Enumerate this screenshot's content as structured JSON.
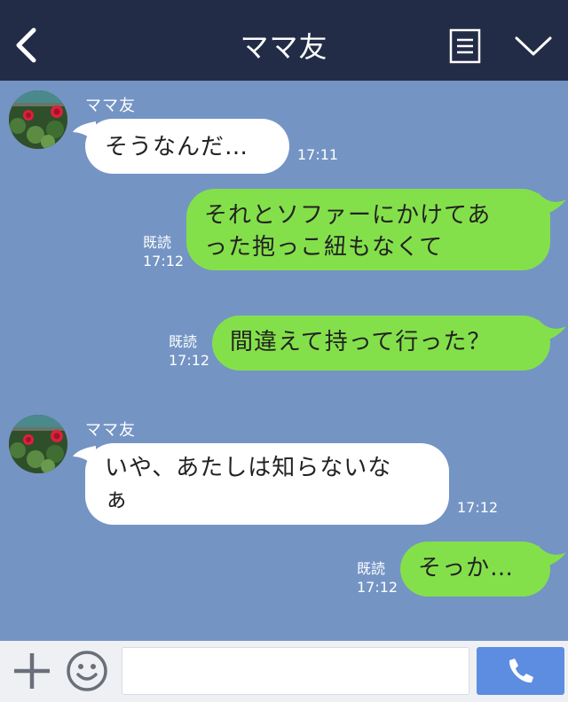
{
  "header": {
    "title": "ママ友",
    "icons": [
      "back-icon",
      "menu-icon",
      "chevron-down-icon"
    ]
  },
  "messages": [
    {
      "side": "in",
      "sender": "ママ友",
      "lines": [
        "そうなんだ…"
      ],
      "time": "17:11"
    },
    {
      "side": "out",
      "read": "既読",
      "lines": [
        "それとソファーにかけてあ",
        "った抱っこ紐もなくて"
      ],
      "time": "17:12"
    },
    {
      "side": "out",
      "read": "既読",
      "lines": [
        "間違えて持って行った？"
      ],
      "time": "17:12"
    },
    {
      "side": "in",
      "sender": "ママ友",
      "lines": [
        "いや、あたしは知らないな",
        "ぁ"
      ],
      "time": "17:12"
    },
    {
      "side": "out",
      "read": "既読",
      "lines": [
        "そっか…"
      ],
      "time": "17:12"
    }
  ],
  "footer": {
    "input_value": "",
    "icons": [
      "plus-icon",
      "emoji-icon",
      "phone-icon"
    ]
  },
  "colors": {
    "header_bg": "#232c47",
    "chat_bg": "#7494c4",
    "incoming_bubble": "#ffffff",
    "outgoing_bubble": "#84e04a",
    "call_button": "#5d8de0"
  }
}
